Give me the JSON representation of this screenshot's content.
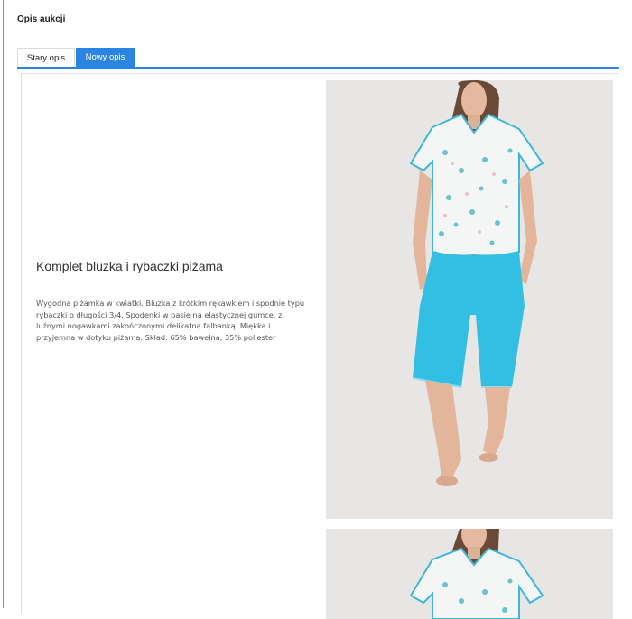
{
  "section": {
    "title": "Opis aukcji"
  },
  "tabs": [
    {
      "label": "Stary opis",
      "active": false
    },
    {
      "label": "Nowy opis",
      "active": true
    }
  ],
  "product": {
    "title": "Komplet bluzka i rybaczki piżama",
    "description": "Wygodna piżamka w kwiatki. Bluzka z krótkim rękawkiem i spodnie typu rybaczki o długości 3/4. Spodenki w pasie na elastycznej gumce, z luźnymi nogawkami zakończonymi delikatną falbanką. Miękka i przyjemna w dotyku piżama. Skład: 65% bawełna, 35% poliester"
  },
  "colors": {
    "accent": "#2a85e2",
    "pants": "#33bfe3",
    "photo_bg": "#e7e6e4"
  },
  "icons": []
}
